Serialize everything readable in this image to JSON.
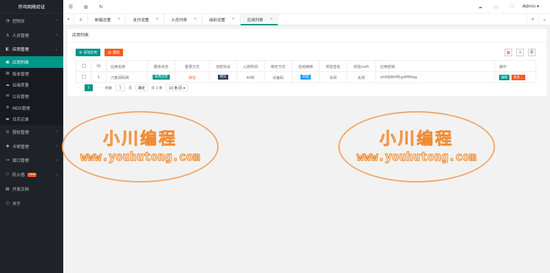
{
  "brand": "炸鸡网络验证",
  "sidebar": {
    "items": [
      {
        "label": "控制台",
        "icon": "dashboard-icon",
        "glyph": "◔",
        "caret": "›"
      },
      {
        "label": "人员管理",
        "icon": "user-icon",
        "glyph": "♙",
        "caret": "›"
      },
      {
        "label": "应用管理",
        "icon": "app-icon",
        "glyph": "◧",
        "caret": "⌄"
      }
    ],
    "sub": [
      {
        "label": "应用列表",
        "glyph": "▣",
        "active": true
      },
      {
        "label": "版本管理",
        "glyph": "▤"
      },
      {
        "label": "云端变量",
        "glyph": "☁"
      },
      {
        "label": "公告管理",
        "glyph": "✉"
      },
      {
        "label": "MD5管理",
        "glyph": "✣"
      },
      {
        "label": "日志记录",
        "glyph": "▬"
      }
    ],
    "items2": [
      {
        "label": "授权管理",
        "glyph": "⊙",
        "caret": "›"
      },
      {
        "label": "卡密管理",
        "glyph": "✚",
        "caret": "›"
      },
      {
        "label": "接口管理",
        "glyph": "⊸",
        "caret": "›"
      },
      {
        "label": "防火墙",
        "glyph": "⚐",
        "caret": "›",
        "badge": "new"
      },
      {
        "label": "开发文档",
        "glyph": "▤"
      },
      {
        "label": "关于",
        "glyph": "ⓘ"
      }
    ]
  },
  "header": {
    "user": "Admin ▾"
  },
  "tabs": [
    {
      "label": "邮箱设置"
    },
    {
      "label": "支付设置"
    },
    {
      "label": "人员列表"
    },
    {
      "label": "级别设置"
    },
    {
      "label": "应用列表",
      "active": true
    }
  ],
  "card": {
    "title": "应用列表",
    "add_label": "添加应用",
    "delete_label": "删除"
  },
  "table": {
    "headers": [
      "ID",
      "应用名称",
      "服务状态",
      "登录方式",
      "加密协议",
      "心跳时间",
      "绑定方式",
      "自动换绑",
      "校验签名",
      "校验md5",
      "应用密钥",
      "操作"
    ],
    "rows": [
      {
        "id": "1",
        "name": "刀客源码网",
        "status": "收费运营",
        "login": "账名",
        "protocol": "明文",
        "heartbeat": "60秒",
        "bind": "设备码",
        "autobind": "开启",
        "sign": "关闭",
        "md5": "关闭",
        "key": "yk68JBKM5gdMMlqg",
        "edit": "编辑",
        "more": "更多 ⌄"
      }
    ]
  },
  "pager": {
    "prev": "‹",
    "current": "1",
    "next": "›",
    "goto_label": "到第",
    "page_input": "1",
    "page_unit": "页",
    "confirm": "确定",
    "total": "共 1 条",
    "size": "10 条/页 ▾"
  },
  "watermark": {
    "cn": "小川编程",
    "en": "www.youhutong.com"
  },
  "colors": {
    "sidebar_bg": "#20222a",
    "accent": "#009688",
    "danger": "#ff5722",
    "watermark": "#f08a30"
  }
}
